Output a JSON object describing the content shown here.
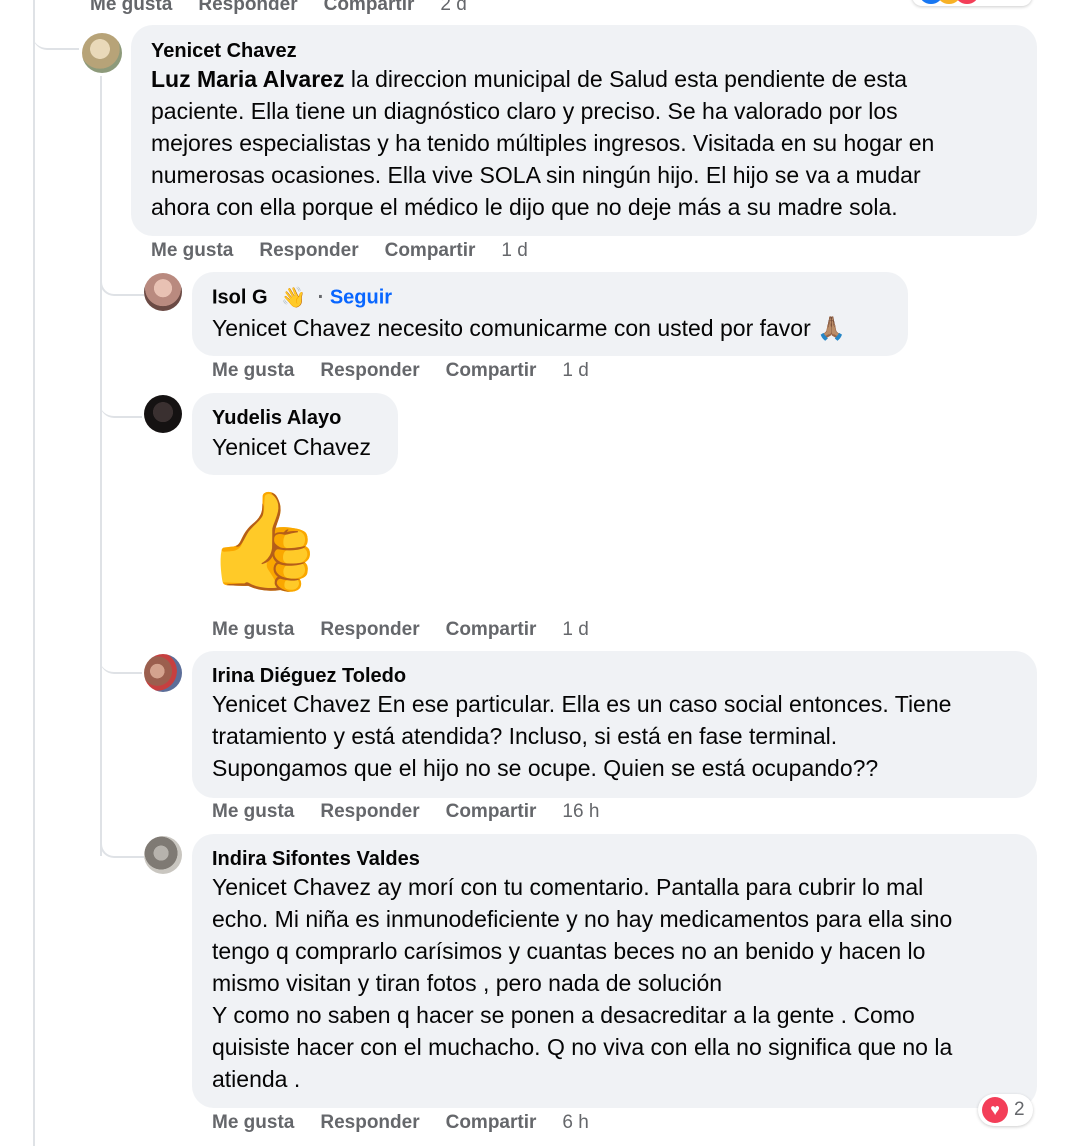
{
  "actions": {
    "like": "Me gusta",
    "reply": "Responder",
    "share": "Compartir"
  },
  "top_partial": {
    "time": "2 d"
  },
  "comments": [
    {
      "name": "Yenicet Chavez",
      "mention": "Luz Maria Alvarez",
      "lines": [
        " la direccion municipal de Salud esta pendiente de esta",
        "paciente. Ella tiene un diagnóstico claro y preciso. Se ha valorado por los",
        "mejores especialistas y ha tenido múltiples ingresos. Visitada en su hogar en",
        "numerosas ocasiones. Ella vive SOLA sin ningún hijo. El hijo se va a mudar",
        "ahora con ella porque el médico le dijo que no deje más a su madre sola."
      ],
      "time": "1 d"
    },
    {
      "name": "Isol G",
      "follow": "Seguir",
      "separator": "·",
      "text": "Yenicet Chavez necesito comunicarme con usted por favor 🙏🏽",
      "time": "1 d"
    },
    {
      "name": "Yudelis Alayo",
      "text": "Yenicet Chavez",
      "sticker": "👍",
      "time": "1 d"
    },
    {
      "name": "Irina Diéguez Toledo",
      "lines": [
        "Yenicet Chavez En ese particular. Ella es un caso social entonces. Tiene",
        "tratamiento y está atendida? Incluso, si está en fase terminal.",
        "Supongamos que el hijo no se ocupe. Quien se está ocupando??"
      ],
      "time": "16 h"
    },
    {
      "name": "Indira Sifontes Valdes",
      "lines": [
        "Yenicet Chavez ay morí con tu comentario. Pantalla para cubrir lo mal",
        "echo. Mi niña es inmunodeficiente y no hay medicamentos para ella sino",
        "tengo q comprarlo carísimos y cuantas beces no an benido y hacen lo",
        "mismo visitan y tiran fotos , pero nada de solución",
        "Y como no saben q hacer se ponen a desacreditar a la gente . Como",
        "quisiste hacer con el muchacho. Q no viva con ella no significa que no la",
        "atienda ."
      ],
      "time": "6 h",
      "reactions": {
        "count": "2",
        "icon": "heart-icon"
      }
    }
  ],
  "colors": {
    "bubble": "#f0f2f5",
    "link": "#0866ff",
    "meta": "#65676b",
    "heart": "#f33e58"
  }
}
